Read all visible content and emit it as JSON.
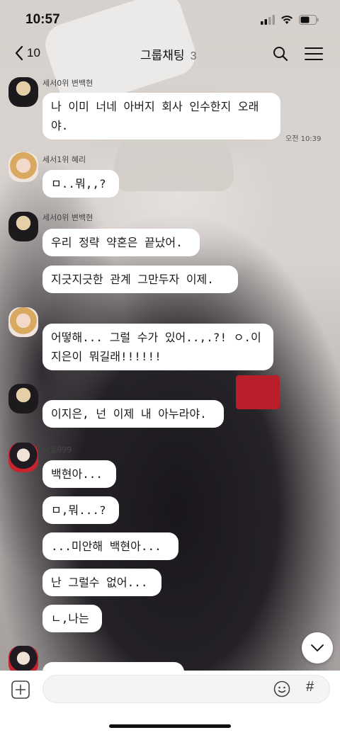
{
  "status_bar": {
    "time": "10:57"
  },
  "header": {
    "back_count": "10",
    "title": "그룹채팅",
    "member_count": "3"
  },
  "messages": [
    {
      "sender": "세서0위 변백현",
      "avatar": "a",
      "lines": [
        "나 이미 너네 아버지 회사 인수한지 오래\n야."
      ],
      "time": "오전 10:39"
    },
    {
      "sender": "세서1위 혜리",
      "avatar": "b",
      "lines": [
        "ㅁ..뭐,,?"
      ]
    },
    {
      "sender": "세서0위 변백현",
      "avatar": "a",
      "lines": [
        "우리 정략 약혼은 끝났어.",
        "지긋지긋한 관계 그만두자 이제."
      ]
    },
    {
      "sender": "",
      "avatar": "b",
      "lines": [
        "어떻해... 그럴 수가 있어..,.?! ㅇ.이\n지은이 뭐길래!!!!!!"
      ]
    },
    {
      "sender": "",
      "avatar": "a",
      "lines": [
        "이지은, 넌 이제 내 아누라야."
      ]
    },
    {
      "sender": "서열999",
      "avatar": "c",
      "lines": [
        "백현아...",
        "ㅁ,뭐...?",
        "...미안해 백현아...",
        "난 그럴수 없어...",
        "ㄴ,나는"
      ]
    },
    {
      "sender": "",
      "avatar": "c",
      "lines": [
        ""
      ]
    }
  ],
  "input": {
    "placeholder": ""
  },
  "icons": {
    "back": "chevron-left-icon",
    "search": "search-icon",
    "menu": "hamburger-menu-icon",
    "plus": "plus-icon",
    "emoji": "emoji-icon",
    "hash": "#",
    "scroll": "chevron-down-icon"
  }
}
